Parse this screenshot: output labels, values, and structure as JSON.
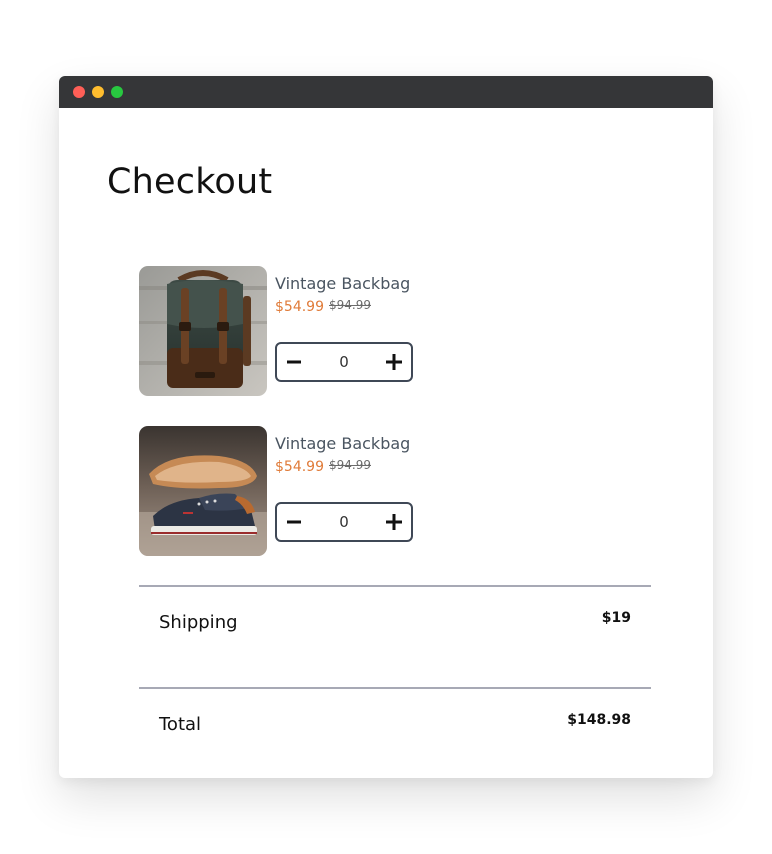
{
  "window": {
    "controls": [
      "close",
      "minimize",
      "maximize"
    ]
  },
  "page": {
    "title": "Checkout"
  },
  "cart": {
    "items": [
      {
        "name": "Vintage Backbag",
        "price": "$54.99",
        "old_price": "$94.99",
        "quantity": "0",
        "image_icon": "backpack-photo"
      },
      {
        "name": "Vintage Backbag",
        "price": "$54.99",
        "old_price": "$94.99",
        "quantity": "0",
        "image_icon": "shoes-photo"
      }
    ]
  },
  "summary": {
    "shipping_label": "Shipping",
    "shipping_value": "$19",
    "total_label": "Total",
    "total_value": "$148.98"
  },
  "colors": {
    "titlebar": "#353638",
    "price": "#e07b39",
    "stepper_border": "#3f4856",
    "divider": "#a7a9b5"
  },
  "icons": {
    "decrement": "minus-icon",
    "increment": "plus-icon"
  }
}
